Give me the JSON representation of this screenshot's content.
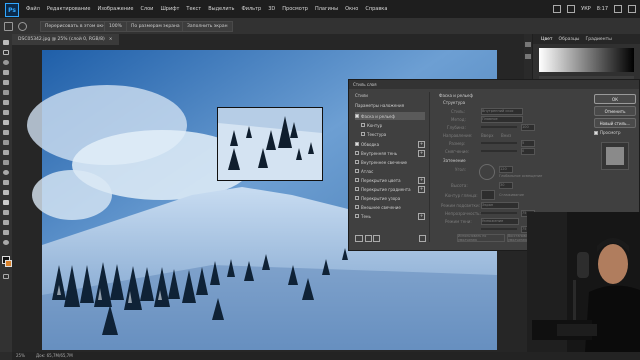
{
  "menu": {
    "items": [
      "Файл",
      "Редактирование",
      "Изображение",
      "Слои",
      "Шрифт",
      "Текст",
      "Выделить",
      "Фильтр",
      "3D",
      "Просмотр",
      "Плагины",
      "Окно",
      "Справка"
    ]
  },
  "system": {
    "lang": "УКР",
    "time": "8:17"
  },
  "options": {
    "btn1": "Перерисовать в этом окне",
    "btn2": "100%",
    "btn3": "По размерам экрана",
    "btn4": "Заполнить экран"
  },
  "document": {
    "tab_title": "DSC05342.jpg @ 25% (слой 0, RGB/8)"
  },
  "status": {
    "zoom": "25%",
    "info": "Док: 65,7M/65,7M"
  },
  "panels": {
    "tabs": [
      "Цвет",
      "Образцы",
      "Градиенты"
    ]
  },
  "dialog": {
    "title": "Стиль слоя",
    "left_header": "Стили",
    "blend_options": "Параметры наложения",
    "items": [
      {
        "label": "Фаска и рельеф",
        "checked": true,
        "active": true
      },
      {
        "label": "Контур",
        "checked": false
      },
      {
        "label": "Текстура",
        "checked": false
      },
      {
        "label": "Обводка",
        "checked": true,
        "plus": true
      },
      {
        "label": "Внутренняя тень",
        "checked": false,
        "plus": true
      },
      {
        "label": "Внутреннее свечение",
        "checked": false
      },
      {
        "label": "Атлас",
        "checked": false
      },
      {
        "label": "Перекрытие цвета",
        "checked": false,
        "plus": true
      },
      {
        "label": "Перекрытие градиента",
        "checked": false,
        "plus": true
      },
      {
        "label": "Перекрытие узора",
        "checked": false
      },
      {
        "label": "Внешнее свечение",
        "checked": false
      },
      {
        "label": "Тень",
        "checked": false,
        "plus": true
      }
    ],
    "section_title": "Фаска и рельеф",
    "structure": "Структура",
    "shading": "Затенение",
    "ok": "ОК",
    "cancel": "Отменить",
    "new_style": "Новый стиль...",
    "preview": "Просмотр",
    "fields": {
      "style": "Стиль:",
      "style_val": "Внутренний скос",
      "method": "Метод:",
      "method_val": "Плавное",
      "depth": "Глубина:",
      "depth_val": "100",
      "direction": "Направление:",
      "up": "Вверх",
      "down": "Вниз",
      "size": "Размер:",
      "size_val": "5",
      "soften": "Смягчение:",
      "soften_val": "0",
      "angle": "Угол:",
      "angle_val": "120",
      "global_light": "Глобальное освещение",
      "altitude": "Высота:",
      "altitude_val": "30",
      "gloss": "Контур глянца:",
      "antialias": "Сглаживание",
      "highlight": "Режим подсветки:",
      "highlight_val": "Экран",
      "opacity": "Непрозрачность:",
      "opacity_val": "75",
      "shadow": "Режим тени:",
      "shadow_val": "Умножение",
      "opacity2_val": "75",
      "make_default": "Использовать по умолчанию",
      "reset_default": "Восстановить значения по умолчанию"
    }
  }
}
